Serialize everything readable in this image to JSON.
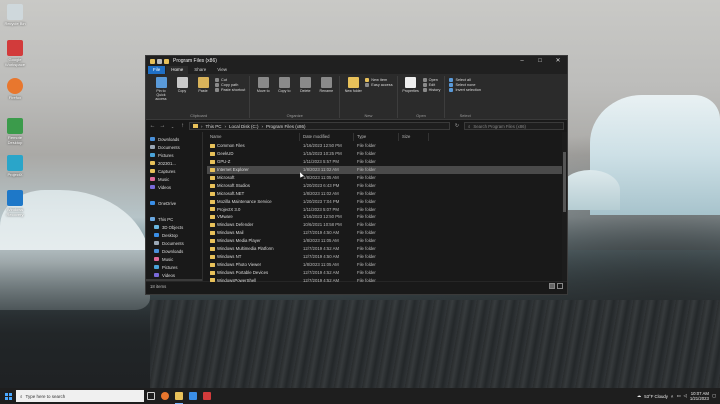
{
  "desktop": {
    "icons": [
      {
        "label": "Recycle Bin",
        "color": "#cfd8dc"
      },
      {
        "label": "Google Workspace",
        "color": "#d23b3b"
      },
      {
        "label": "Firefox",
        "color": "#e8772e"
      },
      {
        "label": "Remote Desktop",
        "color": "#3b9b4b"
      },
      {
        "label": "ProjectX",
        "color": "#2aa5c9"
      },
      {
        "label": "Windows Recovery",
        "color": "#1e78c8"
      }
    ]
  },
  "window": {
    "title": "Program Files (x86)",
    "controls": [
      "–",
      "□",
      "✕"
    ]
  },
  "ribbon": {
    "tabs": [
      "File",
      "Home",
      "Share",
      "View"
    ],
    "active_tab": "Home",
    "clipboard": {
      "group": "Clipboard",
      "pin": "Pin to Quick access",
      "copy": "Copy",
      "paste": "Paste",
      "cut": "Cut",
      "copy_path": "Copy path",
      "paste_shortcut": "Paste shortcut"
    },
    "organize": {
      "group": "Organize",
      "move_to": "Move to",
      "copy_to": "Copy to",
      "delete": "Delete",
      "rename": "Rename"
    },
    "new": {
      "group": "New",
      "new_folder": "New folder",
      "new_item": "New item",
      "easy_access": "Easy access"
    },
    "open": {
      "group": "Open",
      "properties": "Properties",
      "open": "Open",
      "edit": "Edit",
      "history": "History"
    },
    "select": {
      "group": "Select",
      "select_all": "Select all",
      "select_none": "Select none",
      "invert": "Invert selection"
    }
  },
  "address": {
    "path": [
      "This PC",
      "Local Disk (C:)",
      "Program Files (x86)"
    ],
    "search_placeholder": "Search Program Files (x86)"
  },
  "nav": {
    "items": [
      {
        "label": "Downloads",
        "color": "#4a90d9",
        "selected": false
      },
      {
        "label": "Documents",
        "color": "#9aa7b5",
        "selected": false
      },
      {
        "label": "Pictures",
        "color": "#4aa3d9",
        "selected": false
      },
      {
        "label": "202301...",
        "color": "#e8c15a",
        "selected": false
      },
      {
        "label": "Captures",
        "color": "#e8c15a",
        "selected": false
      },
      {
        "label": "Music",
        "color": "#e06a9a",
        "selected": false
      },
      {
        "label": "Videos",
        "color": "#7a6ad9",
        "selected": false
      },
      {
        "label": "",
        "color": "transparent",
        "selected": false
      },
      {
        "label": "OneDrive",
        "color": "#3a8ee6",
        "selected": false
      },
      {
        "label": "",
        "color": "transparent",
        "selected": false
      },
      {
        "label": "This PC",
        "color": "#6aa7e0",
        "selected": false
      },
      {
        "label": "3D Objects",
        "color": "#6ab7e0",
        "selected": false
      },
      {
        "label": "Desktop",
        "color": "#3a8ee6",
        "selected": false
      },
      {
        "label": "Documents",
        "color": "#9aa7b5",
        "selected": false
      },
      {
        "label": "Downloads",
        "color": "#4a90d9",
        "selected": false
      },
      {
        "label": "Music",
        "color": "#e06a9a",
        "selected": false
      },
      {
        "label": "Pictures",
        "color": "#4aa3d9",
        "selected": false
      },
      {
        "label": "Videos",
        "color": "#7a6ad9",
        "selected": false
      },
      {
        "label": "Local Disk (C:)",
        "color": "#9a9a9a",
        "selected": true
      }
    ]
  },
  "files": {
    "headers": {
      "name": "Name",
      "date": "Date modified",
      "type": "Type",
      "size": "Size"
    },
    "rows": [
      {
        "name": "Common Files",
        "date": "1/16/2023 12:50 PM",
        "type": "File folder",
        "selected": false
      },
      {
        "name": "GeekUD",
        "date": "1/15/2023 10:25 PM",
        "type": "File folder",
        "selected": false
      },
      {
        "name": "GPU-Z",
        "date": "1/11/2023 5:57 PM",
        "type": "File folder",
        "selected": false
      },
      {
        "name": "Internet Explorer",
        "date": "1/8/2023 11:02 AM",
        "type": "File folder",
        "selected": true
      },
      {
        "name": "Microsoft",
        "date": "1/8/2023 11:05 AM",
        "type": "File folder",
        "selected": false
      },
      {
        "name": "Microsoft Studios",
        "date": "1/20/2023 6:43 PM",
        "type": "File folder",
        "selected": false
      },
      {
        "name": "Microsoft.NET",
        "date": "1/8/2023 11:02 AM",
        "type": "File folder",
        "selected": false
      },
      {
        "name": "Mozilla Maintenance Service",
        "date": "1/20/2023 7:04 PM",
        "type": "File folder",
        "selected": false
      },
      {
        "name": "ProjectX 3.0",
        "date": "1/11/2023 5:07 PM",
        "type": "File folder",
        "selected": false
      },
      {
        "name": "VMware",
        "date": "1/16/2023 12:50 PM",
        "type": "File folder",
        "selected": false
      },
      {
        "name": "Windows Defender",
        "date": "10/6/2021 10:58 PM",
        "type": "File folder",
        "selected": false
      },
      {
        "name": "Windows Mail",
        "date": "12/7/2019 4:50 AM",
        "type": "File folder",
        "selected": false
      },
      {
        "name": "Windows Media Player",
        "date": "1/8/2023 11:05 AM",
        "type": "File folder",
        "selected": false
      },
      {
        "name": "Windows Multimedia Platform",
        "date": "12/7/2019 4:52 AM",
        "type": "File folder",
        "selected": false
      },
      {
        "name": "Windows NT",
        "date": "12/7/2019 4:50 AM",
        "type": "File folder",
        "selected": false
      },
      {
        "name": "Windows Photo Viewer",
        "date": "1/8/2023 11:05 AM",
        "type": "File folder",
        "selected": false
      },
      {
        "name": "Windows Portable Devices",
        "date": "12/7/2019 4:52 AM",
        "type": "File folder",
        "selected": false
      },
      {
        "name": "WindowsPowerShell",
        "date": "12/7/2019 4:52 AM",
        "type": "File folder",
        "selected": false
      }
    ]
  },
  "status": {
    "count": "18 items"
  },
  "taskbar": {
    "search_placeholder": "Type here to search",
    "apps": [
      {
        "name": "task-view",
        "color": "#cfcfcf"
      },
      {
        "name": "firefox",
        "color": "#e8772e"
      },
      {
        "name": "file-explorer",
        "color": "#e8c15a"
      },
      {
        "name": "mail",
        "color": "#3a8ee6"
      },
      {
        "name": "red-app",
        "color": "#d23b3b"
      }
    ],
    "weather": "53°F Cloudy",
    "time": "10:07 AM",
    "date": "1/21/2023"
  }
}
